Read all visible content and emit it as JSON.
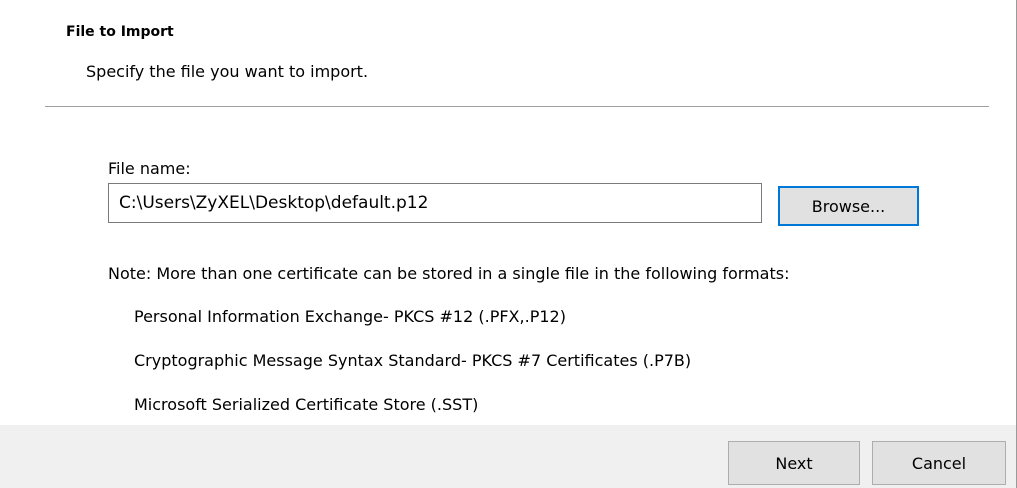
{
  "header": {
    "title": "File to Import",
    "subtitle": "Specify the file you want to import."
  },
  "file": {
    "label": "File name:",
    "value": "C:\\Users\\ZyXEL\\Desktop\\default.p12",
    "browse_label": "Browse..."
  },
  "note": "Note:  More than one certificate can be stored in a single file in the following formats:",
  "formats": [
    "Personal Information Exchange- PKCS #12 (.PFX,.P12)",
    "Cryptographic Message Syntax Standard- PKCS #7 Certificates (.P7B)",
    "Microsoft Serialized Certificate Store (.SST)"
  ],
  "footer": {
    "next_label": "Next",
    "cancel_label": "Cancel"
  },
  "colors": {
    "footer_bg": "#f0f0f0",
    "button_bg": "#e1e1e1",
    "focus_border": "#0078d7"
  }
}
